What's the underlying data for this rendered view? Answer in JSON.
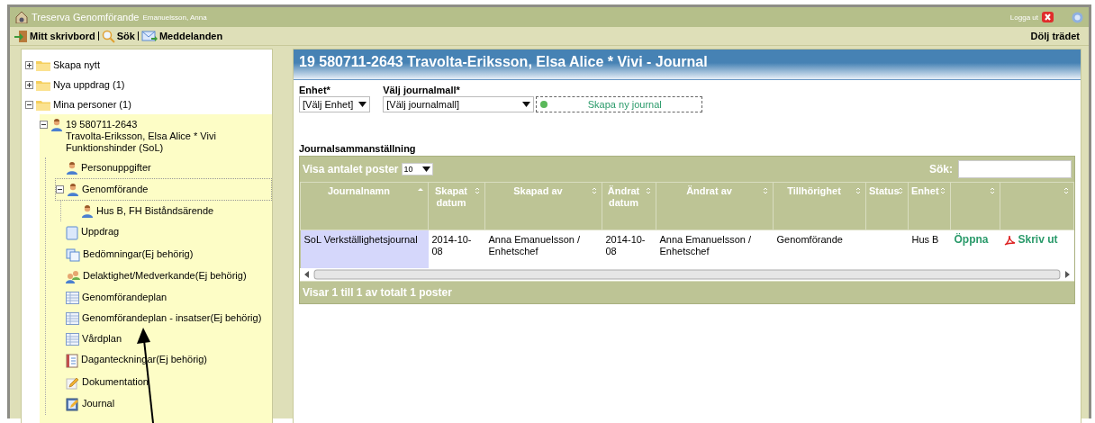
{
  "window": {
    "title": "Treserva Genomförande",
    "user": "Emanuelsson, Anna",
    "logout": "Logga ut"
  },
  "toolbar": {
    "items": [
      {
        "label": "Mitt skrivbord"
      },
      {
        "label": "Sök"
      },
      {
        "label": "Meddelanden"
      }
    ],
    "hide_tree": "Dölj trädet"
  },
  "tree": [
    {
      "lines": [
        "Skapa nytt"
      ],
      "kind": "folder",
      "expanded": false,
      "selected": false
    },
    {
      "lines": [
        "Nya uppdrag (1)"
      ],
      "kind": "folder",
      "expanded": false,
      "selected": false
    },
    {
      "lines": [
        "Mina personer (1)"
      ],
      "kind": "folder",
      "expanded": true,
      "selected": false,
      "children": [
        {
          "lines": [
            "19 580711-2643",
            "Travolta-Eriksson, Elsa Alice * Vivi",
            "Funktionshinder (SoL)"
          ],
          "kind": "person",
          "expanded": true,
          "selected": false,
          "children": [
            {
              "lines": [
                "Personuppgifter"
              ],
              "kind": "person",
              "selected": false
            },
            {
              "lines": [
                "Genomförande"
              ],
              "kind": "person",
              "expanded": true,
              "selected": true,
              "children": [
                {
                  "lines": [
                    "Hus B, FH Biståndsärende"
                  ],
                  "kind": "person",
                  "selected": false
                }
              ]
            },
            {
              "lines": [
                "Uppdrag"
              ],
              "kind": "document",
              "selected": false
            },
            {
              "lines": [
                "Bedömningar(Ej behörig)"
              ],
              "kind": "copies",
              "selected": false
            },
            {
              "lines": [
                "Delaktighet/Medverkande(Ej behörig)"
              ],
              "kind": "people",
              "selected": false
            },
            {
              "lines": [
                "Genomförandeplan"
              ],
              "kind": "grid",
              "selected": false
            },
            {
              "lines": [
                "Genomförandeplan - insatser(Ej behörig)"
              ],
              "kind": "grid",
              "selected": false
            },
            {
              "lines": [
                "Vårdplan"
              ],
              "kind": "grid",
              "selected": false
            },
            {
              "lines": [
                "Daganteckningar(Ej behörig)"
              ],
              "kind": "notebook",
              "selected": false
            },
            {
              "lines": [
                "Dokumentation"
              ],
              "kind": "pencil",
              "selected": false
            },
            {
              "lines": [
                "Journal"
              ],
              "kind": "journal",
              "selected": false
            }
          ]
        }
      ]
    }
  ],
  "panel": {
    "title": "19 580711-2643 Travolta-Eriksson, Elsa Alice * Vivi - Journal",
    "unit_field": {
      "label": "Enhet*",
      "value": "[Välj Enhet]"
    },
    "template_field": {
      "label": "Välj journalmall*",
      "value": "[Välj journalmall]"
    },
    "create_button": "Skapa ny journal",
    "section_title": "Journalsammanställning",
    "page_size": {
      "label": "Visa antalet poster",
      "value": "10"
    },
    "search": {
      "label": "Sök:"
    },
    "table": {
      "columns": [
        {
          "label": "Journalnamn",
          "kind": "sorted"
        },
        {
          "label": "Skapat datum",
          "kind": "sortable"
        },
        {
          "label": "Skapad av",
          "kind": "sortable"
        },
        {
          "label": "Ändrat datum",
          "kind": "sortable"
        },
        {
          "label": "Ändrat av",
          "kind": "sortable"
        },
        {
          "label": "Tillhörighet",
          "kind": "sortable"
        },
        {
          "label": "Status",
          "kind": "sortable"
        },
        {
          "label": "Enhet",
          "kind": "sortable"
        },
        {
          "kind": "sortable"
        },
        {
          "kind": "sortable"
        }
      ],
      "rows": [
        {
          "cells": [
            {
              "kind": "text",
              "text": "SoL Verkställighetsjournal"
            },
            {
              "kind": "text",
              "text": "2014-10-08"
            },
            {
              "kind": "text",
              "text": "Anna Emanuelsson / Enhetschef"
            },
            {
              "kind": "text",
              "text": "2014-10-08"
            },
            {
              "kind": "text",
              "text": "Anna Emanuelsson / Enhetschef"
            },
            {
              "kind": "text",
              "text": "Genomförande"
            },
            {
              "kind": "text",
              "text": ""
            },
            {
              "kind": "text",
              "text": "Hus B"
            },
            {
              "kind": "link",
              "text": "Öppna"
            },
            {
              "kind": "pdf-link",
              "text": "Skriv ut"
            }
          ]
        }
      ]
    },
    "footer": "Visar 1 till 1 av totalt 1 poster"
  }
}
